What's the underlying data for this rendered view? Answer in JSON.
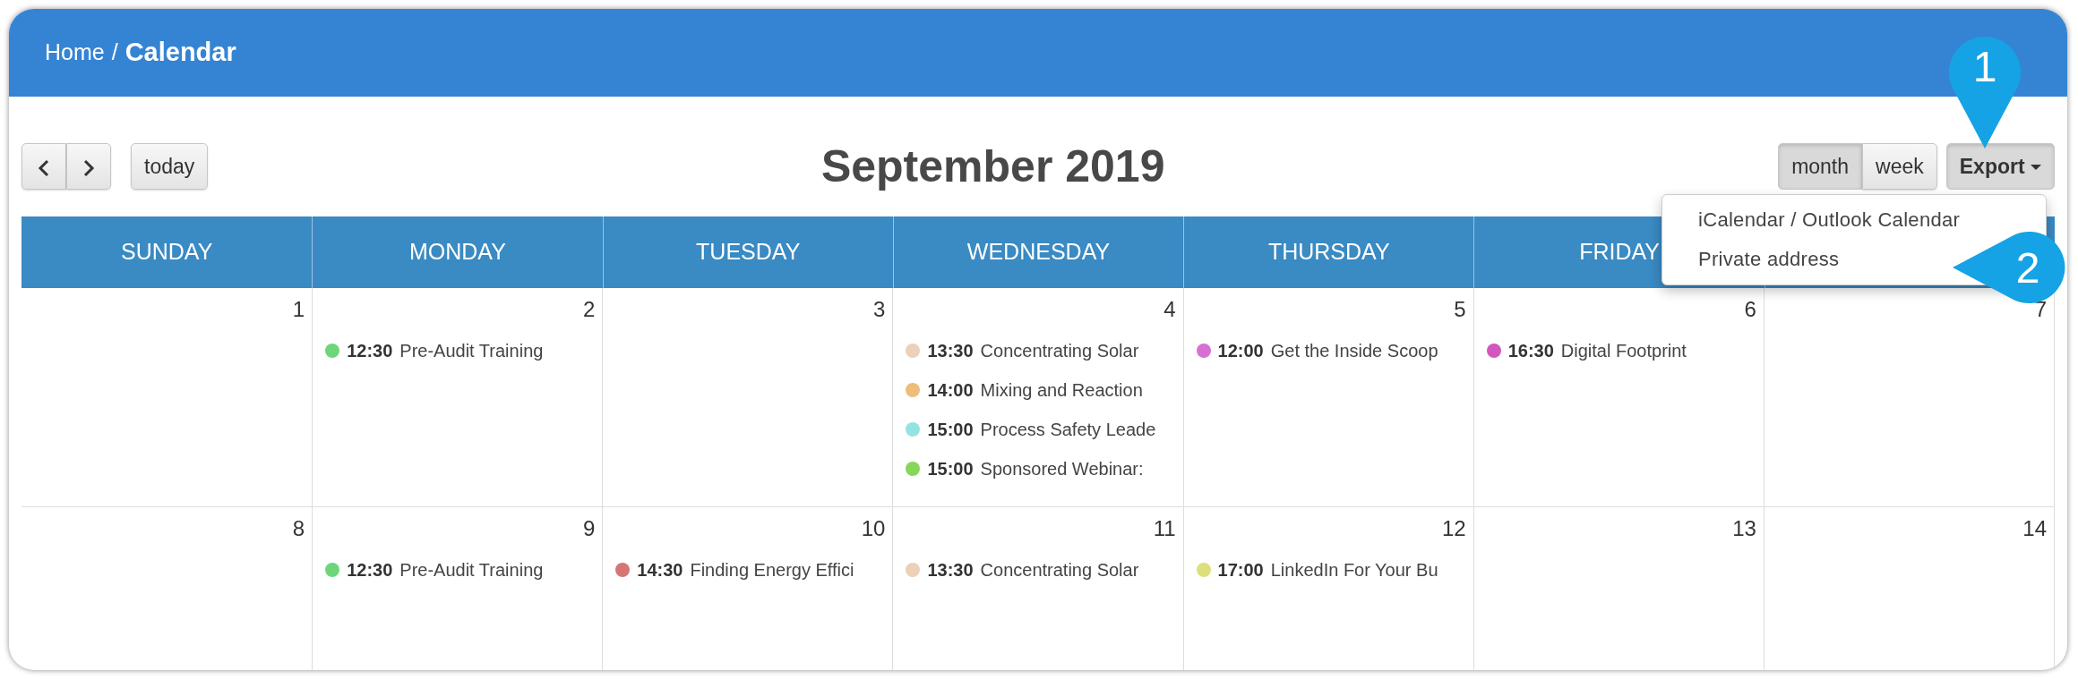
{
  "breadcrumb": {
    "parent": "Home",
    "separator": "/",
    "current": "Calendar"
  },
  "toolbar": {
    "today": "today",
    "title": "September 2019",
    "views": [
      {
        "label": "month",
        "selected": true
      },
      {
        "label": "week",
        "selected": false
      }
    ],
    "export": {
      "label": "Export",
      "expanded": true
    }
  },
  "export_menu": {
    "items": [
      "iCalendar / Outlook Calendar",
      "Private address"
    ]
  },
  "callouts": [
    "1",
    "2"
  ],
  "weekdays": [
    "SUNDAY",
    "MONDAY",
    "TUESDAY",
    "WEDNESDAY",
    "THURSDAY",
    "FRIDAY"
  ],
  "weeks": [
    {
      "days": [
        {
          "number": "1"
        },
        {
          "number": "2",
          "events": [
            {
              "time": "12:30",
              "title": "Pre-Audit Training",
              "color": "#6dd67a"
            }
          ]
        },
        {
          "number": "3"
        },
        {
          "number": "4",
          "events": [
            {
              "time": "13:30",
              "title": "Concentrating Solar",
              "color": "#ecd0b8"
            },
            {
              "time": "14:00",
              "title": "Mixing and Reaction",
              "color": "#edbd7b"
            },
            {
              "time": "15:00",
              "title": "Process Safety Leade",
              "color": "#94e3e1"
            },
            {
              "time": "15:00",
              "title": "Sponsored Webinar:",
              "color": "#86d65a"
            }
          ]
        },
        {
          "number": "5",
          "events": [
            {
              "time": "12:00",
              "title": "Get the Inside Scoop",
              "color": "#d870d4"
            }
          ]
        },
        {
          "number": "6",
          "events": [
            {
              "time": "16:30",
              "title": "Digital Footprint",
              "color": "#d356bd"
            }
          ]
        },
        {
          "number": "7"
        }
      ]
    },
    {
      "days": [
        {
          "number": "8"
        },
        {
          "number": "9",
          "events": [
            {
              "time": "12:30",
              "title": "Pre-Audit Training",
              "color": "#6dd67a"
            }
          ]
        },
        {
          "number": "10",
          "events": [
            {
              "time": "14:30",
              "title": "Finding Energy Effici",
              "color": "#d67575"
            }
          ]
        },
        {
          "number": "11",
          "events": [
            {
              "time": "13:30",
              "title": "Concentrating Solar",
              "color": "#ecd0b8"
            }
          ]
        },
        {
          "number": "12",
          "events": [
            {
              "time": "17:00",
              "title": "LinkedIn For Your Bu",
              "color": "#dbe07a"
            }
          ]
        },
        {
          "number": "13"
        },
        {
          "number": "14"
        }
      ]
    }
  ]
}
